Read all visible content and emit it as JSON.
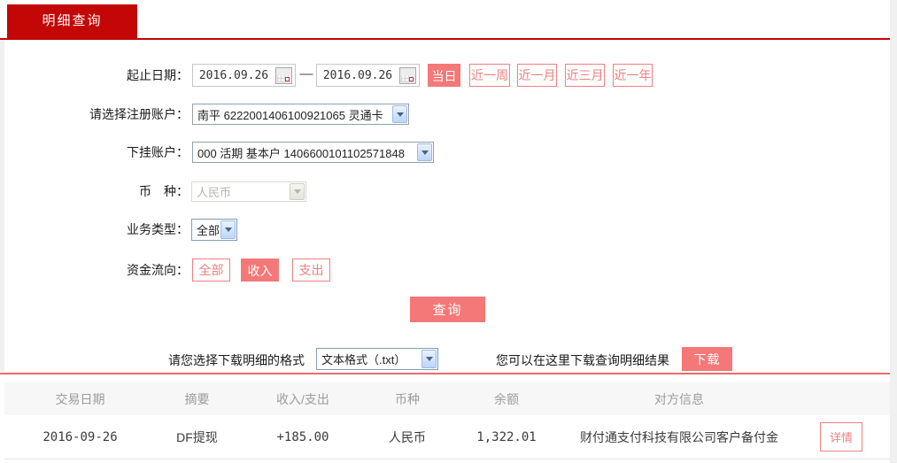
{
  "colors": {
    "primary_red": "#c30606",
    "salmon_fill": "#f47878",
    "salmon_border": "#f08080",
    "amount_red": "#cc0000",
    "divider_red": "#ec6c6c"
  },
  "tab": {
    "label": "明细查询"
  },
  "form": {
    "date_row": {
      "label": "起止日期：",
      "start_date": "2016.09.26",
      "end_date": "2016.09.26",
      "separator": "—",
      "quick_ranges": [
        {
          "label": "当日",
          "active": true
        },
        {
          "label": "近一周",
          "active": false
        },
        {
          "label": "近一月",
          "active": false
        },
        {
          "label": "近三月",
          "active": false
        },
        {
          "label": "近一年",
          "active": false
        }
      ]
    },
    "account_row": {
      "label": "请选择注册账户：",
      "value": "南平 6222001406100921065 灵通卡"
    },
    "sub_account_row": {
      "label": "下挂账户：",
      "value": "000 活期 基本户 1406600101102571848"
    },
    "currency_row": {
      "label": "币　种：",
      "value": "人民币",
      "disabled": true
    },
    "biz_type_row": {
      "label": "业务类型：",
      "value": "全部"
    },
    "flow_row": {
      "label": "资金流向：",
      "options": [
        {
          "label": "全部",
          "active": false
        },
        {
          "label": "收入",
          "active": true
        },
        {
          "label": "支出",
          "active": false
        }
      ]
    },
    "query_button": "查询"
  },
  "download": {
    "format_label": "请您选择下载明细的格式",
    "format_value": "文本格式（.txt）",
    "hint": "您可以在这里下载查询明细结果",
    "button": "下载"
  },
  "table": {
    "headers": [
      "交易日期",
      "摘要",
      "收入/支出",
      "币种",
      "余额",
      "对方信息"
    ],
    "rows": [
      {
        "date": "2016-09-26",
        "summary": "DF提现",
        "amount": "+185.00",
        "currency": "人民币",
        "balance": "1,322.01",
        "counterparty": "财付通支付科技有限公司客户备付金",
        "detail_label": "详情"
      }
    ]
  }
}
